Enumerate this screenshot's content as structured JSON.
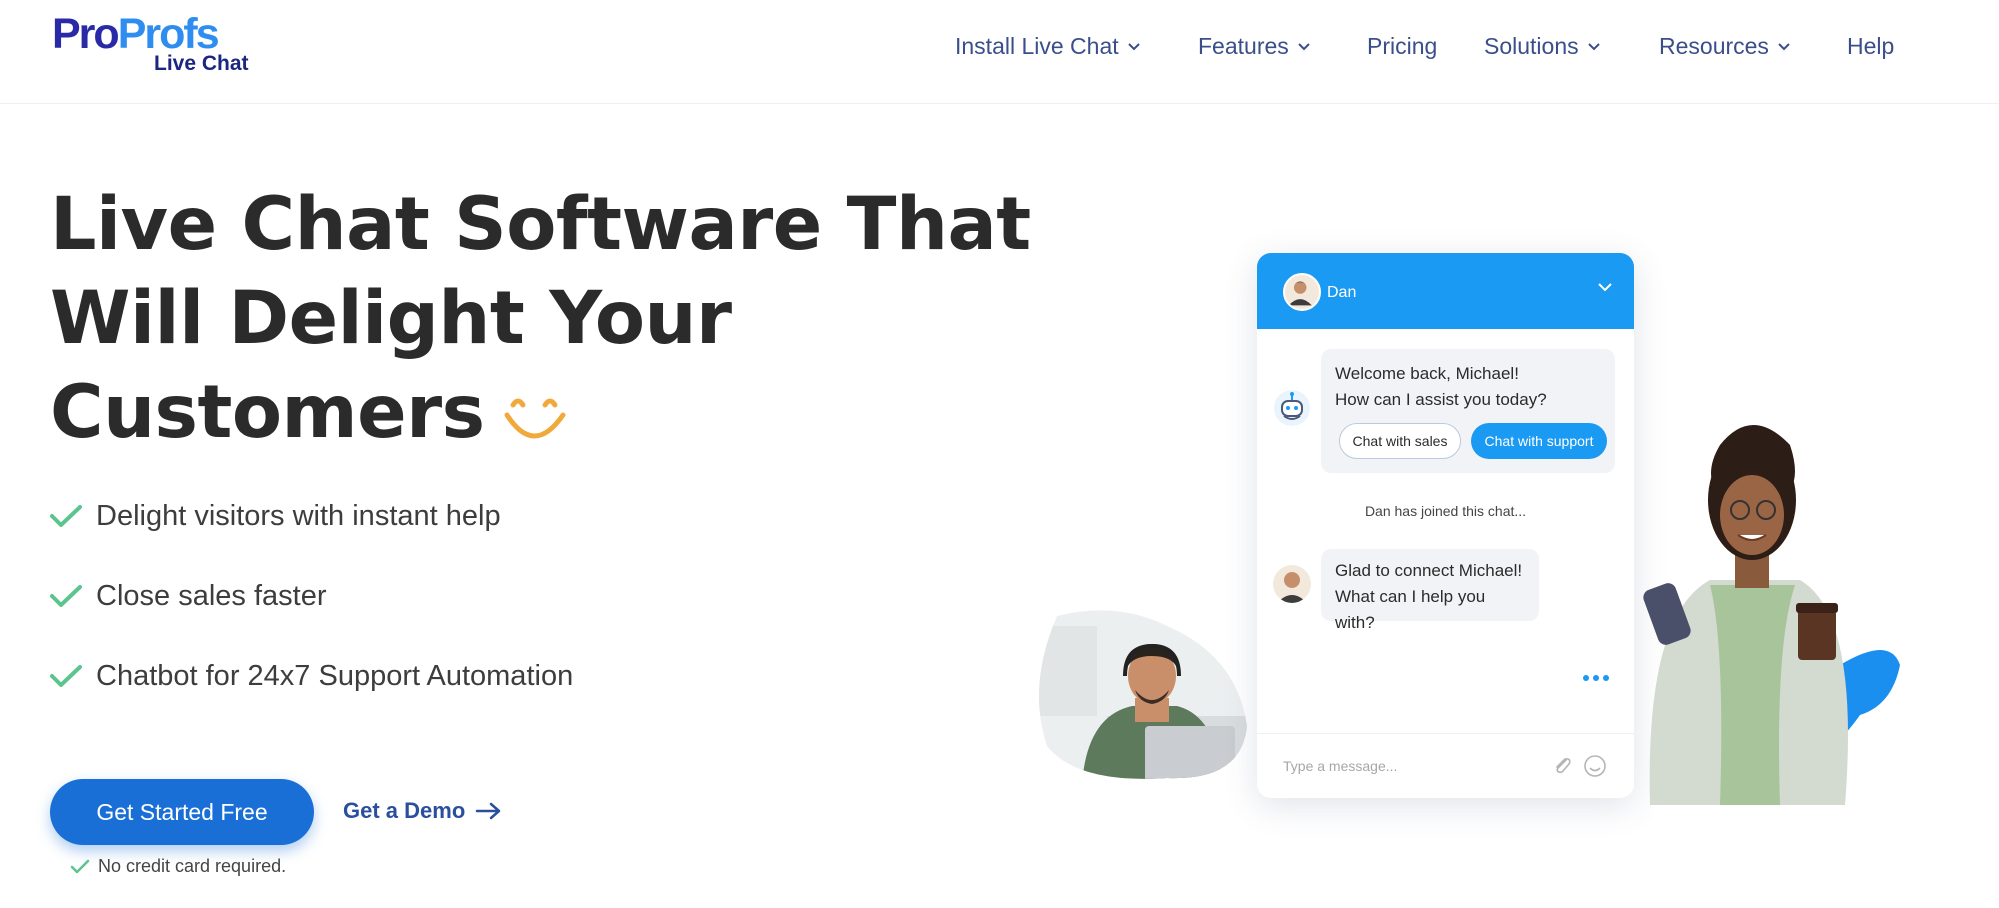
{
  "logo": {
    "brand_part1": "Pro",
    "brand_part2": "Profs",
    "sub": "Live Chat"
  },
  "nav": [
    {
      "label": "Install Live Chat",
      "has_dropdown": true
    },
    {
      "label": "Features",
      "has_dropdown": true
    },
    {
      "label": "Pricing",
      "has_dropdown": false
    },
    {
      "label": "Solutions",
      "has_dropdown": true
    },
    {
      "label": "Resources",
      "has_dropdown": true
    },
    {
      "label": "Help",
      "has_dropdown": false
    }
  ],
  "hero": {
    "title_lines": [
      "Live Chat Software That",
      "Will Delight Your",
      "Customers"
    ],
    "bullets": [
      "Delight visitors with instant help",
      "Close sales faster",
      "Chatbot for 24x7 Support Automation"
    ],
    "cta_label": "Get Started Free",
    "demo_label": "Get a Demo",
    "no_card": "No credit card required."
  },
  "chat": {
    "agent_name": "Dan",
    "welcome_line1": "Welcome back, Michael!",
    "welcome_line2": "How can I assist you today?",
    "chip_sales": "Chat with sales",
    "chip_support": "Chat with support",
    "joined": "Dan has joined this chat...",
    "reply_line1": "Glad to connect Michael!",
    "reply_line2": "What can I help you with?",
    "input_placeholder": "Type a message..."
  },
  "colors": {
    "primary_button": "#1a6fd6",
    "chat_header": "#1a9af2",
    "check_green": "#5cc48e",
    "smile_orange": "#f2a93b",
    "nav_text": "#3a4f8a"
  },
  "icons": [
    "chevron-down-icon",
    "check-icon",
    "arrow-right-icon",
    "smile-icon",
    "bot-icon",
    "paperclip-icon",
    "emoji-icon"
  ]
}
